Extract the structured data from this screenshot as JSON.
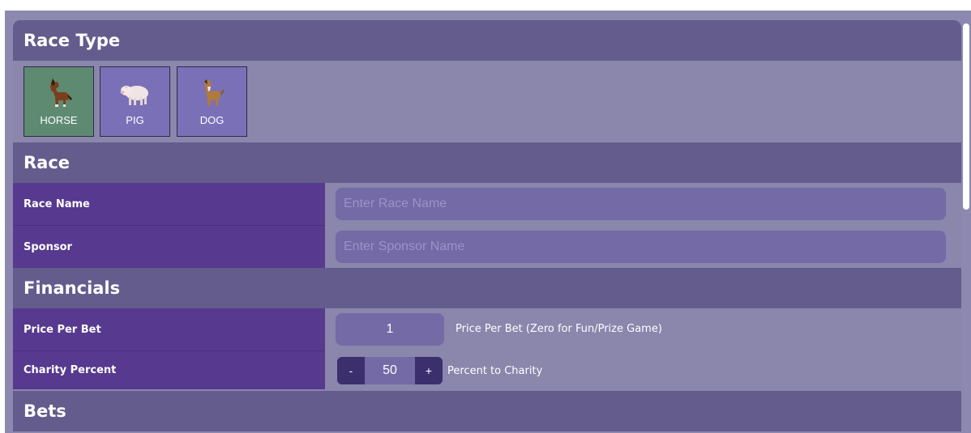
{
  "race_type": {
    "title": "Race Type",
    "options": [
      {
        "label": "HORSE",
        "selected": true
      },
      {
        "label": "PIG",
        "selected": false
      },
      {
        "label": "DOG",
        "selected": false
      }
    ]
  },
  "race": {
    "title": "Race",
    "name_label": "Race Name",
    "name_placeholder": "Enter Race Name",
    "sponsor_label": "Sponsor",
    "sponsor_placeholder": "Enter Sponsor Name"
  },
  "financials": {
    "title": "Financials",
    "price_label": "Price Per Bet",
    "price_value": "1",
    "price_hint": "Price Per Bet (Zero for Fun/Prize Game)",
    "charity_label": "Charity Percent",
    "charity_minus": "-",
    "charity_value": "50",
    "charity_plus": "+",
    "charity_hint": "Percent to Charity"
  },
  "bets": {
    "title": "Bets"
  },
  "colors": {
    "section_header": "#635c8c",
    "label_cell": "#57398f",
    "selected_type": "#5e8a72",
    "type_button": "#7a70b8",
    "input_bg": "#736aa6"
  },
  "icons": {
    "horse": "horse-icon",
    "pig": "pig-icon",
    "dog": "dog-icon"
  }
}
